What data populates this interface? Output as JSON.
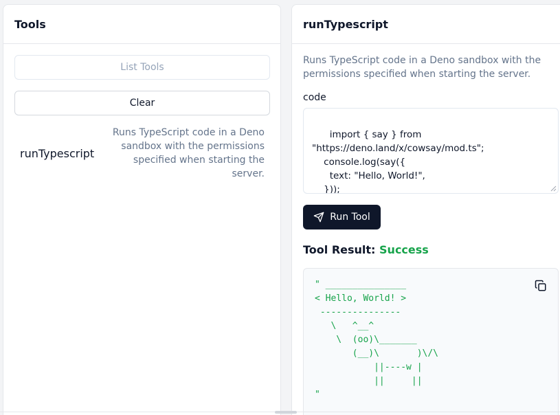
{
  "left": {
    "title": "Tools",
    "list_tools_label": "List Tools",
    "clear_label": "Clear",
    "tools": [
      {
        "name": "runTypescript",
        "description": "Runs TypeScript code in a Deno sandbox with the permissions specified when starting the server."
      }
    ]
  },
  "right": {
    "title": "runTypescript",
    "description": "Runs TypeScript code in a Deno sandbox with the permissions specified when starting the server.",
    "code_label": "code",
    "code_value": "import { say } from \"https://deno.land/x/cowsay/mod.ts\";\n    console.log(say({\n      text: \"Hello, World!\",\n    }));",
    "run_label": "Run Tool",
    "result_label": "Tool Result:",
    "result_status": "Success",
    "result_output": "\" _______________\n< Hello, World! >\n ---------------\n   \\   ^__^\n    \\  (oo)\\_______\n       (__)\\       )\\/\\\n           ||----w |\n           ||     ||\n\""
  },
  "colors": {
    "success": "#16a34a",
    "primary_button": "#0f172a",
    "muted_text": "#64748b"
  },
  "icons": {
    "run": "send-icon",
    "copy": "copy-icon"
  }
}
